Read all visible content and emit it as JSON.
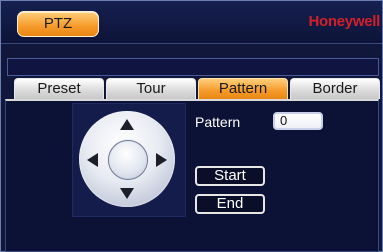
{
  "window": {
    "title_tab": "PTZ",
    "brand": "Honeywell"
  },
  "tabs": [
    {
      "label": "Preset",
      "active": false
    },
    {
      "label": "Tour",
      "active": false
    },
    {
      "label": "Pattern",
      "active": true
    },
    {
      "label": "Border",
      "active": false
    }
  ],
  "pattern": {
    "label": "Pattern",
    "value": "0",
    "start_label": "Start",
    "end_label": "End"
  },
  "icons": {
    "up": "arrow-up-icon",
    "down": "arrow-down-icon",
    "left": "arrow-left-icon",
    "right": "arrow-right-icon"
  },
  "colors": {
    "background": "#0a0e28",
    "accent": "#f59a2a",
    "brand": "#d2202a"
  }
}
